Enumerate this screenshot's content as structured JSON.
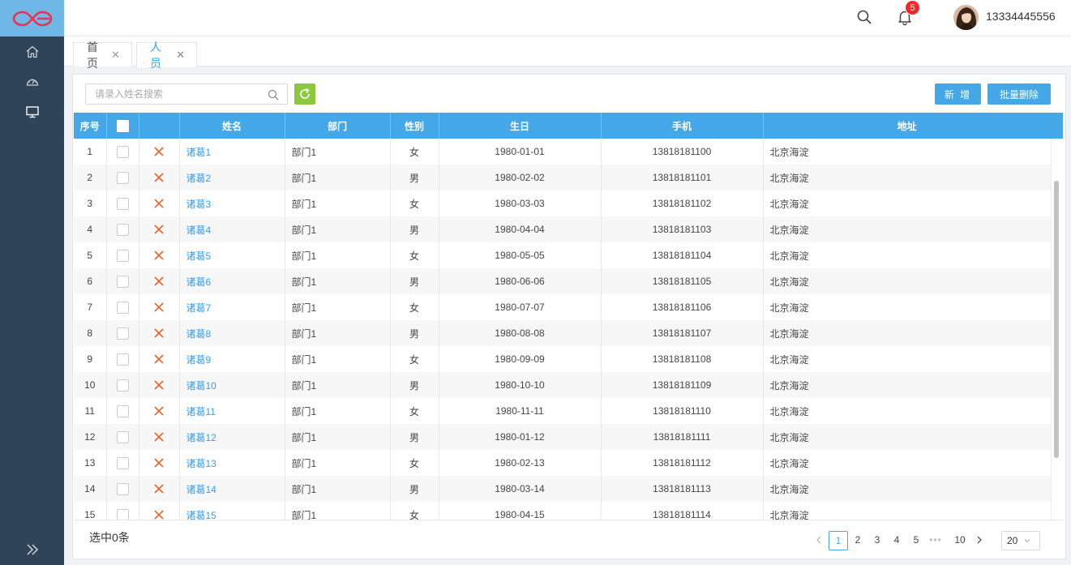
{
  "header": {
    "notification_count": "5",
    "username": "13334445556"
  },
  "tabs": [
    {
      "label": "首页"
    },
    {
      "label": "人员"
    }
  ],
  "toolbar": {
    "search_placeholder": "请录入姓名搜索",
    "add_label": "新 增",
    "batch_delete_label": "批量删除"
  },
  "table": {
    "columns": [
      "序号",
      "",
      "",
      "姓名",
      "部门",
      "性别",
      "生日",
      "手机",
      "地址"
    ],
    "rows": [
      {
        "no": "1",
        "name": "诸葛1",
        "dept": "部门1",
        "gender": "女",
        "birthday": "1980-01-01",
        "phone": "13818181100",
        "address": "北京海淀"
      },
      {
        "no": "2",
        "name": "诸葛2",
        "dept": "部门1",
        "gender": "男",
        "birthday": "1980-02-02",
        "phone": "13818181101",
        "address": "北京海淀"
      },
      {
        "no": "3",
        "name": "诸葛3",
        "dept": "部门1",
        "gender": "女",
        "birthday": "1980-03-03",
        "phone": "13818181102",
        "address": "北京海淀"
      },
      {
        "no": "4",
        "name": "诸葛4",
        "dept": "部门1",
        "gender": "男",
        "birthday": "1980-04-04",
        "phone": "13818181103",
        "address": "北京海淀"
      },
      {
        "no": "5",
        "name": "诸葛5",
        "dept": "部门1",
        "gender": "女",
        "birthday": "1980-05-05",
        "phone": "13818181104",
        "address": "北京海淀"
      },
      {
        "no": "6",
        "name": "诸葛6",
        "dept": "部门1",
        "gender": "男",
        "birthday": "1980-06-06",
        "phone": "13818181105",
        "address": "北京海淀"
      },
      {
        "no": "7",
        "name": "诸葛7",
        "dept": "部门1",
        "gender": "女",
        "birthday": "1980-07-07",
        "phone": "13818181106",
        "address": "北京海淀"
      },
      {
        "no": "8",
        "name": "诸葛8",
        "dept": "部门1",
        "gender": "男",
        "birthday": "1980-08-08",
        "phone": "13818181107",
        "address": "北京海淀"
      },
      {
        "no": "9",
        "name": "诸葛9",
        "dept": "部门1",
        "gender": "女",
        "birthday": "1980-09-09",
        "phone": "13818181108",
        "address": "北京海淀"
      },
      {
        "no": "10",
        "name": "诸葛10",
        "dept": "部门1",
        "gender": "男",
        "birthday": "1980-10-10",
        "phone": "13818181109",
        "address": "北京海淀"
      },
      {
        "no": "11",
        "name": "诸葛11",
        "dept": "部门1",
        "gender": "女",
        "birthday": "1980-11-11",
        "phone": "13818181110",
        "address": "北京海淀"
      },
      {
        "no": "12",
        "name": "诸葛12",
        "dept": "部门1",
        "gender": "男",
        "birthday": "1980-01-12",
        "phone": "13818181111",
        "address": "北京海淀"
      },
      {
        "no": "13",
        "name": "诸葛13",
        "dept": "部门1",
        "gender": "女",
        "birthday": "1980-02-13",
        "phone": "13818181112",
        "address": "北京海淀"
      },
      {
        "no": "14",
        "name": "诸葛14",
        "dept": "部门1",
        "gender": "男",
        "birthday": "1980-03-14",
        "phone": "13818181113",
        "address": "北京海淀"
      },
      {
        "no": "15",
        "name": "诸葛15",
        "dept": "部门1",
        "gender": "女",
        "birthday": "1980-04-15",
        "phone": "13818181114",
        "address": "北京海淀"
      }
    ]
  },
  "footer": {
    "selected_text": "选中0条",
    "pages": [
      "1",
      "2",
      "3",
      "4",
      "5"
    ],
    "ellipsis": "•••",
    "last_page": "10",
    "current_page": "1",
    "page_size": "20"
  },
  "colors": {
    "sidebar": "#2f4458",
    "logo_bg": "#6fb7e6",
    "accent": "#44a8e8",
    "refresh": "#8dc63f",
    "delete_icon": "#e8632b",
    "badge": "#f0282d"
  },
  "icons": {
    "logo": "infinity-logo",
    "sidebar": [
      "home-icon",
      "dashboard-icon",
      "monitor-icon"
    ],
    "collapse": "double-chevron-right-icon",
    "header": [
      "search-icon",
      "bell-icon"
    ],
    "row_action": "close-icon"
  }
}
